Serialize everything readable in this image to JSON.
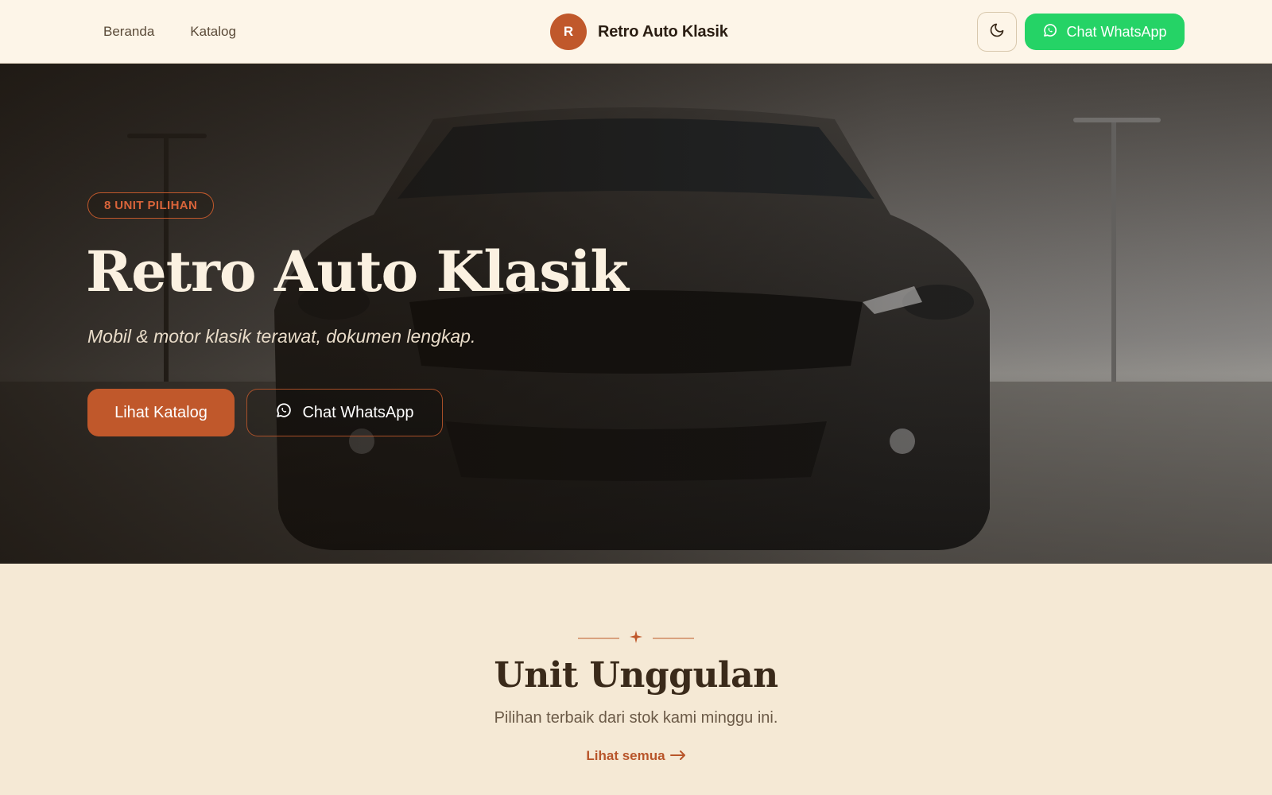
{
  "header": {
    "nav": [
      {
        "label": "Beranda"
      },
      {
        "label": "Katalog"
      }
    ],
    "brand": {
      "initial": "R",
      "name": "Retro Auto Klasik"
    },
    "theme_toggle_icon": "moon-icon",
    "whatsapp_label": "Chat WhatsApp"
  },
  "hero": {
    "badge": "8 UNIT PILIHAN",
    "title": "Retro Auto Klasik",
    "subtitle": "Mobil & motor klasik terawat, dokumen lengkap.",
    "cta_primary": "Lihat Katalog",
    "cta_secondary": "Chat WhatsApp",
    "background_subject": "car-photo"
  },
  "featured": {
    "divider_icon": "sparkle-icon",
    "title": "Unit Unggulan",
    "subtitle": "Pilihan terbaik dari stok kami minggu ini.",
    "see_all": "Lihat semua",
    "see_all_icon": "arrow-right-icon"
  },
  "colors": {
    "accent": "#c0582b",
    "whatsapp": "#25d366",
    "header_bg": "#fdf5e8",
    "page_bg": "#f5e9d5"
  }
}
